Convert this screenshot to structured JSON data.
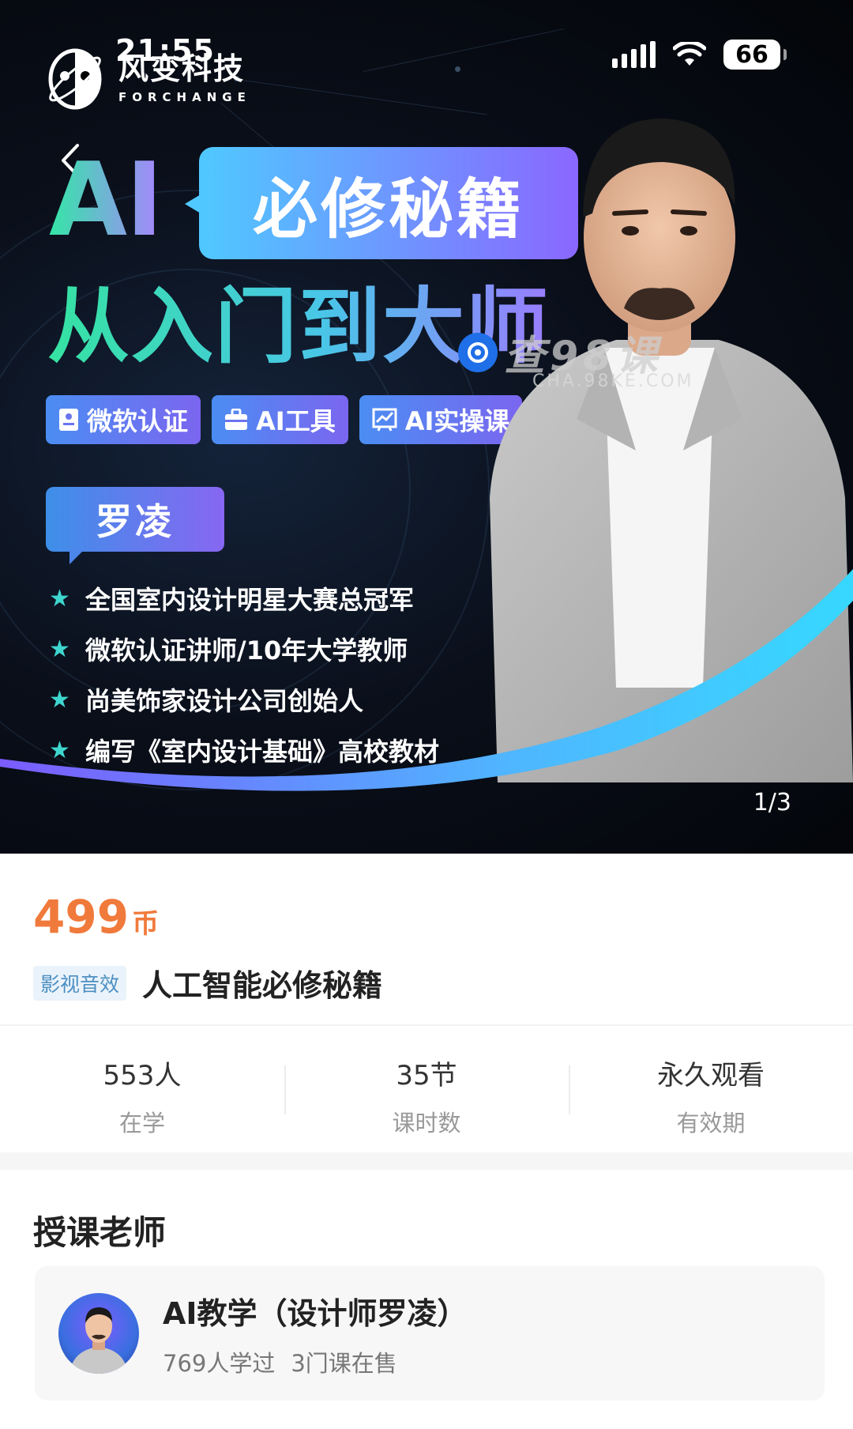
{
  "status_bar": {
    "time": "21:55",
    "battery": "66"
  },
  "logo": {
    "name_zh": "风变科技",
    "name_en": "FORCHANGE"
  },
  "banner": {
    "ai": "AI",
    "title": "必修秘籍",
    "subtitle": "从入门到大师",
    "tags": [
      "微软认证",
      "AI工具",
      "AI实操课"
    ],
    "teacher_name": "罗凌",
    "credentials": [
      "全国室内设计明星大赛总冠军",
      "微软认证讲师/10年大学教师",
      "尚美饰家设计公司创始人",
      "编写《室内设计基础》高校教材"
    ],
    "watermark": "查98课",
    "watermark_url": "CHA.98KE.COM",
    "page_indicator": "1/3"
  },
  "course": {
    "price": "499",
    "price_unit": "币",
    "category": "影视音效",
    "title": "人工智能必修秘籍"
  },
  "stats": [
    {
      "value": "553人",
      "label": "在学"
    },
    {
      "value": "35节",
      "label": "课时数"
    },
    {
      "value": "永久观看",
      "label": "有效期"
    }
  ],
  "teacher_section": {
    "heading": "授课老师",
    "name": "AI教学（设计师罗凌）",
    "learners": "769人学过",
    "courses": "3门课在售"
  },
  "colors": {
    "price": "#f07a3b",
    "accent_green": "#34e6a6",
    "accent_purple": "#8a67ff"
  }
}
